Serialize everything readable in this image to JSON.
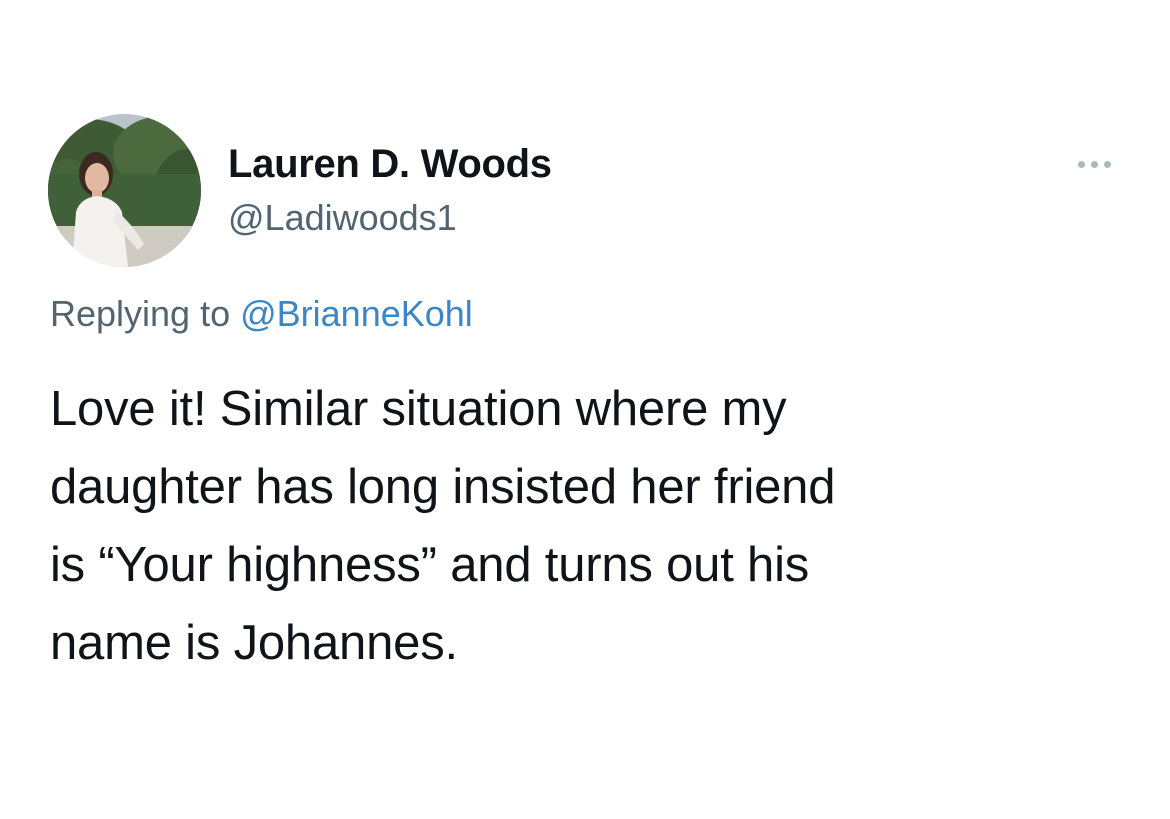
{
  "author": {
    "display_name": "Lauren D. Woods",
    "handle": "@Ladiwoods1"
  },
  "more_menu": {
    "icon": "more-horizontal-icon"
  },
  "reply": {
    "prefix": "Replying to ",
    "mention": "@BrianneKohl"
  },
  "tweet": {
    "lines": [
      "Love it! Similar situation where my",
      "daughter has long insisted her friend",
      "is “Your highness” and turns out his",
      "name is Johannes."
    ]
  },
  "colors": {
    "text": "#0f1419",
    "secondary_text": "#536471",
    "mention": "#3b86c4",
    "more_dots": "#aab8c2"
  }
}
